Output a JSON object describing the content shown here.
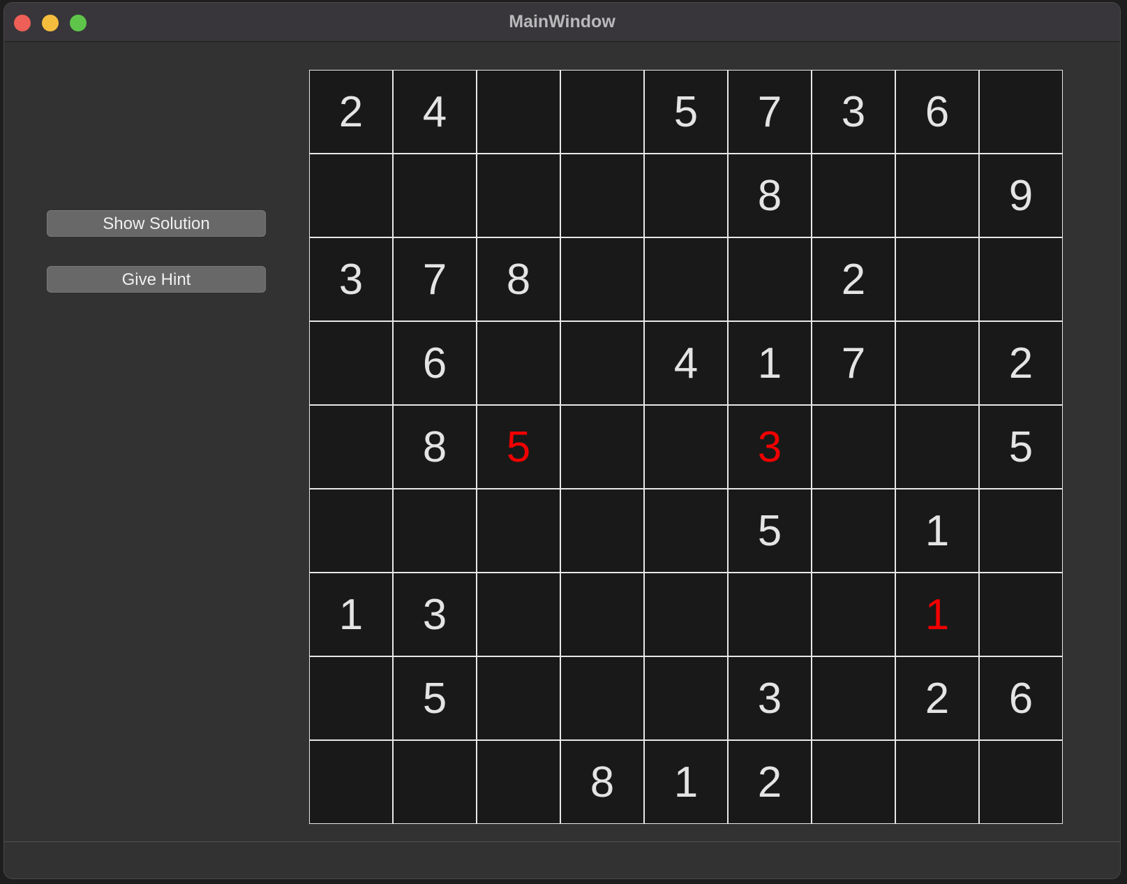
{
  "window": {
    "title": "MainWindow"
  },
  "buttons": {
    "show_solution": "Show Solution",
    "give_hint": "Give Hint"
  },
  "colors": {
    "given": "#e4e4e4",
    "hint": "#f00000"
  },
  "board": {
    "rows": [
      [
        {
          "v": "2",
          "t": "given"
        },
        {
          "v": "4",
          "t": "given"
        },
        {
          "v": "",
          "t": "empty"
        },
        {
          "v": "",
          "t": "empty"
        },
        {
          "v": "5",
          "t": "given"
        },
        {
          "v": "7",
          "t": "given"
        },
        {
          "v": "3",
          "t": "given"
        },
        {
          "v": "6",
          "t": "given"
        },
        {
          "v": "",
          "t": "empty"
        }
      ],
      [
        {
          "v": "",
          "t": "empty"
        },
        {
          "v": "",
          "t": "empty"
        },
        {
          "v": "",
          "t": "empty"
        },
        {
          "v": "",
          "t": "empty"
        },
        {
          "v": "",
          "t": "empty"
        },
        {
          "v": "8",
          "t": "given"
        },
        {
          "v": "",
          "t": "empty"
        },
        {
          "v": "",
          "t": "empty"
        },
        {
          "v": "9",
          "t": "given"
        }
      ],
      [
        {
          "v": "3",
          "t": "given"
        },
        {
          "v": "7",
          "t": "given"
        },
        {
          "v": "8",
          "t": "given"
        },
        {
          "v": "",
          "t": "empty"
        },
        {
          "v": "",
          "t": "empty"
        },
        {
          "v": "",
          "t": "empty"
        },
        {
          "v": "2",
          "t": "given"
        },
        {
          "v": "",
          "t": "empty"
        },
        {
          "v": "",
          "t": "empty"
        }
      ],
      [
        {
          "v": "",
          "t": "empty"
        },
        {
          "v": "6",
          "t": "given"
        },
        {
          "v": "",
          "t": "empty"
        },
        {
          "v": "",
          "t": "empty"
        },
        {
          "v": "4",
          "t": "given"
        },
        {
          "v": "1",
          "t": "given"
        },
        {
          "v": "7",
          "t": "given"
        },
        {
          "v": "",
          "t": "empty"
        },
        {
          "v": "2",
          "t": "given"
        }
      ],
      [
        {
          "v": "",
          "t": "empty"
        },
        {
          "v": "8",
          "t": "given"
        },
        {
          "v": "5",
          "t": "hint"
        },
        {
          "v": "",
          "t": "empty"
        },
        {
          "v": "",
          "t": "empty"
        },
        {
          "v": "3",
          "t": "hint"
        },
        {
          "v": "",
          "t": "empty"
        },
        {
          "v": "",
          "t": "empty"
        },
        {
          "v": "5",
          "t": "given"
        }
      ],
      [
        {
          "v": "",
          "t": "empty"
        },
        {
          "v": "",
          "t": "empty"
        },
        {
          "v": "",
          "t": "empty"
        },
        {
          "v": "",
          "t": "empty"
        },
        {
          "v": "",
          "t": "empty"
        },
        {
          "v": "5",
          "t": "given"
        },
        {
          "v": "",
          "t": "empty"
        },
        {
          "v": "1",
          "t": "given"
        },
        {
          "v": "",
          "t": "empty"
        }
      ],
      [
        {
          "v": "1",
          "t": "given"
        },
        {
          "v": "3",
          "t": "given"
        },
        {
          "v": "",
          "t": "empty"
        },
        {
          "v": "",
          "t": "empty"
        },
        {
          "v": "",
          "t": "empty"
        },
        {
          "v": "",
          "t": "empty"
        },
        {
          "v": "",
          "t": "empty"
        },
        {
          "v": "1",
          "t": "hint"
        },
        {
          "v": "",
          "t": "empty"
        }
      ],
      [
        {
          "v": "",
          "t": "empty"
        },
        {
          "v": "5",
          "t": "given"
        },
        {
          "v": "",
          "t": "empty"
        },
        {
          "v": "",
          "t": "empty"
        },
        {
          "v": "",
          "t": "empty"
        },
        {
          "v": "3",
          "t": "given"
        },
        {
          "v": "",
          "t": "empty"
        },
        {
          "v": "2",
          "t": "given"
        },
        {
          "v": "6",
          "t": "given"
        }
      ],
      [
        {
          "v": "",
          "t": "empty"
        },
        {
          "v": "",
          "t": "empty"
        },
        {
          "v": "",
          "t": "empty"
        },
        {
          "v": "8",
          "t": "given"
        },
        {
          "v": "1",
          "t": "given"
        },
        {
          "v": "2",
          "t": "given"
        },
        {
          "v": "",
          "t": "empty"
        },
        {
          "v": "",
          "t": "empty"
        },
        {
          "v": "",
          "t": "empty"
        }
      ]
    ]
  }
}
